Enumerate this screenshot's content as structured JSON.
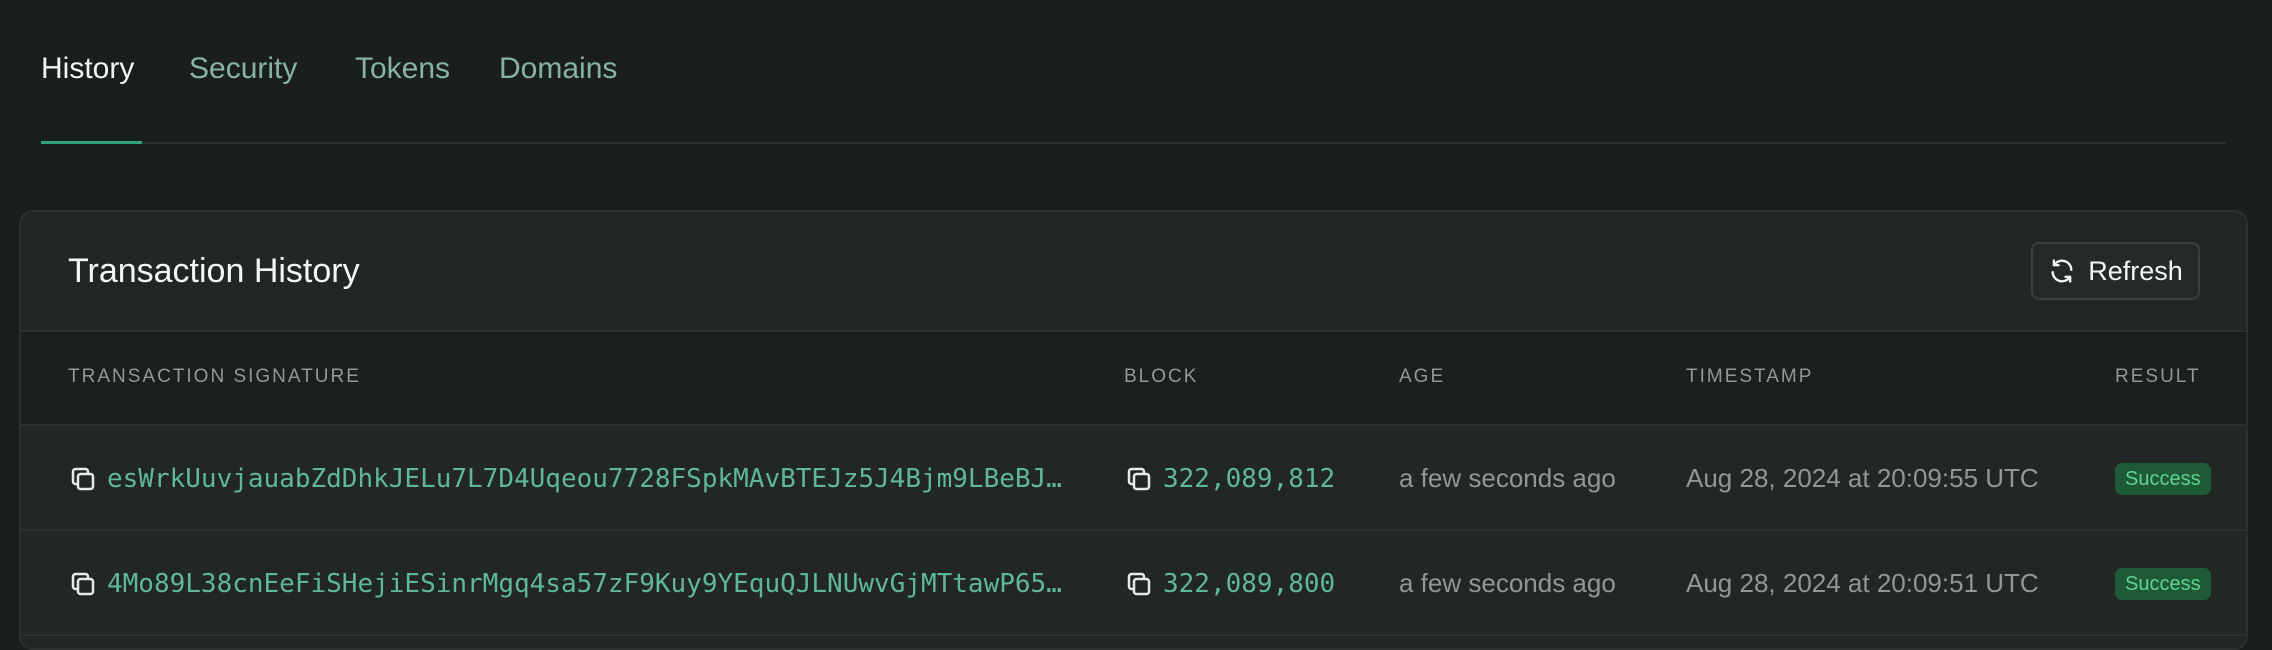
{
  "tabs": [
    {
      "label": "History",
      "active": true
    },
    {
      "label": "Security",
      "active": false
    },
    {
      "label": "Tokens",
      "active": false
    },
    {
      "label": "Domains",
      "active": false
    }
  ],
  "card": {
    "title": "Transaction History",
    "refresh_label": "Refresh"
  },
  "table": {
    "headers": [
      "TRANSACTION SIGNATURE",
      "BLOCK",
      "AGE",
      "TIMESTAMP",
      "RESULT"
    ],
    "rows": [
      {
        "signature": "esWrkUuvjauabZdDhkJELu7L7D4Uqeou7728FSpkMAvBTEJz5J4Bjm9LBeBJ…",
        "block": "322,089,812",
        "age": "a few seconds ago",
        "timestamp": "Aug 28, 2024 at 20:09:55 UTC",
        "result": "Success"
      },
      {
        "signature": "4Mo89L38cnEeFiSHejiESinrMgq4sa57zF9Kuy9YEquQJLNUwvGjMTtawP65…",
        "block": "322,089,800",
        "age": "a few seconds ago",
        "timestamp": "Aug 28, 2024 at 20:09:51 UTC",
        "result": "Success"
      }
    ]
  },
  "colors": {
    "accent": "#2fa37d",
    "link": "#5fb79a",
    "success_bg": "#1f5a36",
    "success_text": "#5fd38e"
  },
  "icons": {
    "copy": "copy-icon",
    "refresh": "refresh-icon"
  }
}
